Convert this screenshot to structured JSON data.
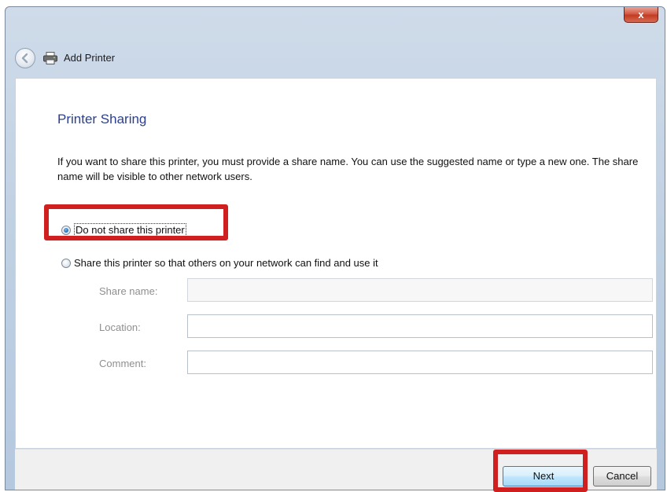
{
  "window": {
    "title": "Add Printer",
    "close_label": "x"
  },
  "page": {
    "heading": "Printer Sharing",
    "description": "If you want to share this printer, you must provide a share name. You can use the suggested name or type a new one. The share name will be visible to other network users."
  },
  "options": {
    "do_not_share": {
      "label": "Do not share this printer",
      "checked": true
    },
    "share": {
      "label": "Share this printer so that others on your network can find and use it",
      "checked": false
    }
  },
  "fields": {
    "share_name": {
      "label": "Share name:",
      "value": ""
    },
    "location": {
      "label": "Location:",
      "value": ""
    },
    "comment": {
      "label": "Comment:",
      "value": ""
    }
  },
  "buttons": {
    "next": "Next",
    "cancel": "Cancel"
  },
  "colors": {
    "heading": "#2a3f8f",
    "highlight": "#d01f1f"
  },
  "icons": {
    "back": "back-arrow-icon",
    "printer": "printer-icon",
    "close": "close-icon"
  }
}
